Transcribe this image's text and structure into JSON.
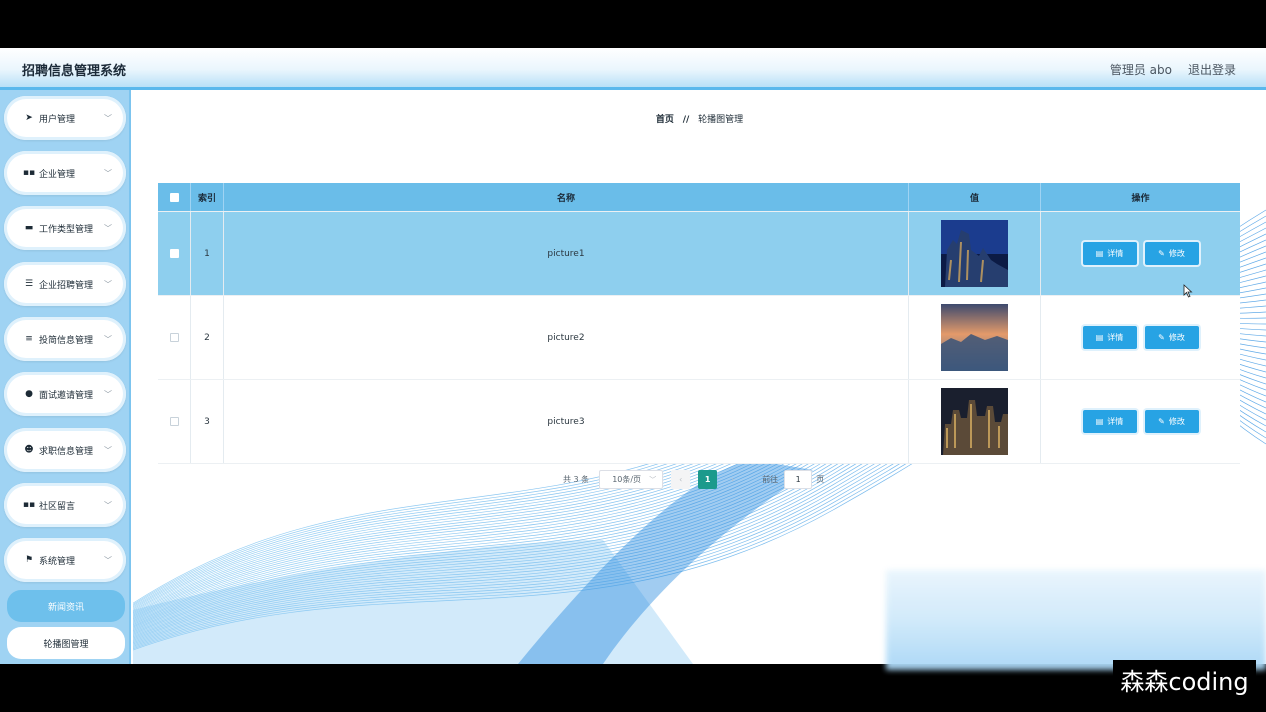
{
  "header": {
    "title": "招聘信息管理系统",
    "user_label": "管理员 abo",
    "logout_label": "退出登录"
  },
  "sidebar": {
    "items": [
      {
        "label": "用户管理",
        "icon": "paper-plane-icon"
      },
      {
        "label": "企业管理",
        "icon": "grid-icon"
      },
      {
        "label": "工作类型管理",
        "icon": "database-icon"
      },
      {
        "label": "企业招聘管理",
        "icon": "sliders-icon"
      },
      {
        "label": "投简信息管理",
        "icon": "list-icon"
      },
      {
        "label": "面试邀请管理",
        "icon": "map-pin-icon"
      },
      {
        "label": "求职信息管理",
        "icon": "user-icon"
      },
      {
        "label": "社区留言",
        "icon": "grid-icon"
      },
      {
        "label": "系统管理",
        "icon": "flag-icon"
      }
    ],
    "sub_items": [
      {
        "label": "新闻资讯",
        "active": true
      },
      {
        "label": "轮播图管理",
        "active": false
      }
    ]
  },
  "breadcrumb": {
    "home": "首页",
    "separator": "//",
    "current": "轮播图管理"
  },
  "table": {
    "columns": [
      "索引",
      "名称",
      "值",
      "操作"
    ],
    "rows": [
      {
        "index": "1",
        "name": "picture1",
        "selected": true
      },
      {
        "index": "2",
        "name": "picture2",
        "selected": false
      },
      {
        "index": "3",
        "name": "picture3",
        "selected": false
      }
    ],
    "detail_label": "详情",
    "edit_label": "修改"
  },
  "pagination": {
    "total_label": "共 3 条",
    "page_size": "10条/页",
    "current_page": "1",
    "goto_label": "前往",
    "goto_value": "1",
    "page_unit": "页"
  },
  "watermark": "森森coding",
  "colors": {
    "accent": "#27a3e4",
    "header_row": "#6abde9",
    "selected_row": "#8ecfee",
    "sidebar_bg": "#9fd3f3",
    "active_page": "#1b9a8c"
  }
}
